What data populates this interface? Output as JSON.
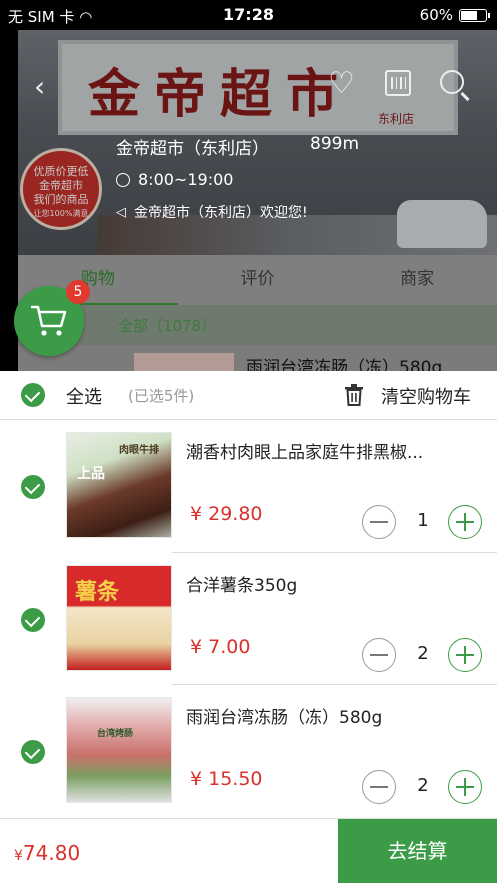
{
  "status_bar": {
    "carrier": "无 SIM 卡",
    "time": "17:28",
    "battery": "60%",
    "battery_level": 0.6
  },
  "store": {
    "sign_text": "金帝超市",
    "sign_sub": "东利店",
    "badge_lines": [
      "优质价更低",
      "金帝超市",
      "我们的商品",
      "让您100%满意"
    ],
    "name": "金帝超市（东利店）",
    "distance": "899m",
    "hours": "8:00~19:00",
    "notice": "金帝超市（东利店）欢迎您!"
  },
  "tabs": [
    {
      "label": "购物",
      "active": true
    },
    {
      "label": "评价",
      "active": false
    },
    {
      "label": "商家",
      "active": false
    }
  ],
  "category": {
    "label": "全部（1078）"
  },
  "background_product": {
    "name": "雨润台湾冻肠（冻）580g"
  },
  "cart_badge": "5",
  "cart_panel": {
    "select_all_label": "全选",
    "selected_count": "(已选5件)",
    "clear_label": "清空购物车",
    "items": [
      {
        "name": "潮香村肉眼上品家庭牛排黑椒...",
        "price": "¥ 29.80",
        "qty": "1",
        "image_tags": [
          "上品",
          "肉眼牛排"
        ]
      },
      {
        "name": "合洋薯条350g",
        "price": "¥ 7.00",
        "qty": "2",
        "image_tags": [
          "薯条"
        ]
      },
      {
        "name": "雨润台湾冻肠（冻）580g",
        "price": "¥ 15.50",
        "qty": "2",
        "image_tags": [
          "台湾烤肠"
        ]
      }
    ]
  },
  "footer": {
    "currency": "¥",
    "total": "74.80",
    "checkout_label": "去结算"
  },
  "colors": {
    "brand_green": "#3b9b46",
    "price_red": "#d9312b",
    "badge_red": "#e03a2e"
  },
  "icons": [
    "back-icon",
    "heart-icon",
    "barcode-icon",
    "search-icon",
    "clock-icon",
    "speaker-icon",
    "cart-icon",
    "check-icon",
    "trash-icon",
    "minus-icon",
    "plus-icon",
    "wifi-icon"
  ]
}
